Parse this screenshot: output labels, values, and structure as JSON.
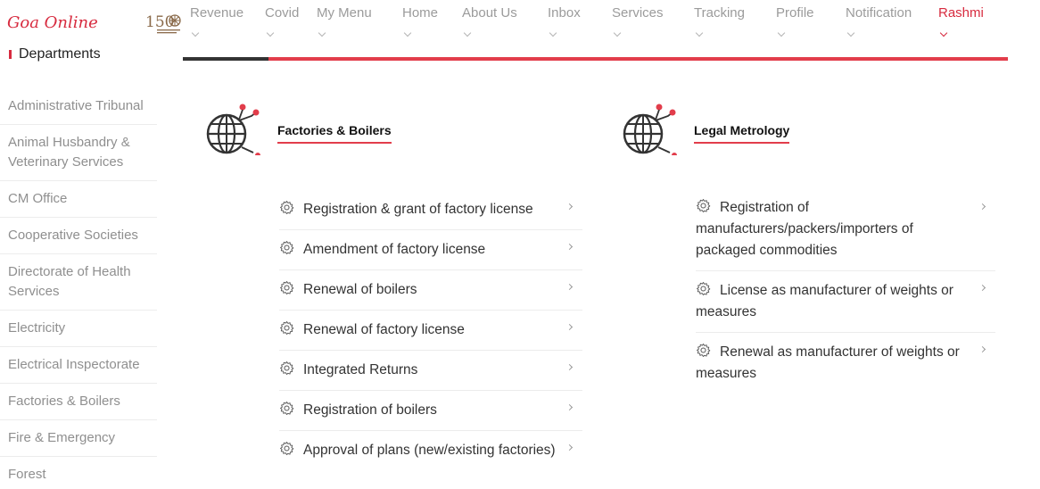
{
  "brand": {
    "name": "Goa Online",
    "logo_text": "150"
  },
  "nav": [
    {
      "label": "Revenue"
    },
    {
      "label": "Covid"
    },
    {
      "label": "My Menu"
    },
    {
      "label": "Home"
    },
    {
      "label": "About Us"
    },
    {
      "label": "Inbox"
    },
    {
      "label": "Services"
    },
    {
      "label": "Tracking"
    },
    {
      "label": "Profile"
    },
    {
      "label": "Notification"
    },
    {
      "label": "Rashmi"
    }
  ],
  "sidebar": {
    "heading": "Departments",
    "items": [
      "Administrative Tribunal",
      "Animal Husbandry & Veterinary Services",
      "CM Office",
      "Cooperative Societies",
      "Directorate of Health Services",
      "Electricity",
      "Electrical Inspectorate",
      "Factories & Boilers",
      "Fire & Emergency",
      "Forest"
    ]
  },
  "departments": {
    "factories": {
      "title": "Factories & Boilers",
      "services": [
        "Registration & grant of factory license",
        "Amendment of factory license",
        "Renewal of boilers",
        "Renewal of factory license",
        "Integrated Returns",
        "Registration of boilers",
        "Approval of plans (new/existing factories)"
      ]
    },
    "metrology": {
      "title": "Legal Metrology",
      "services": [
        "Registration of manufacturers/packers/importers of packaged commodities",
        "License as manufacturer of weights or measures",
        "Renewal as manufacturer of weights or measures"
      ]
    }
  },
  "colors": {
    "accent": "#d72b3f",
    "line": "#e23d4b",
    "muted": "#8f8f8f"
  }
}
